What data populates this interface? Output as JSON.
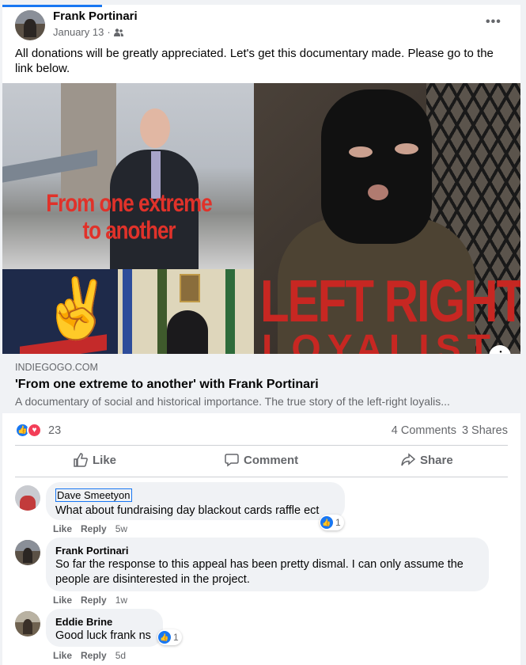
{
  "post": {
    "author": "Frank Portinari",
    "date": "January 13",
    "separator": "·",
    "audience_icon": "friends-icon",
    "more_icon": "more-options-icon",
    "text": "All donations will be greatly appreciated. Let's get this documentary made. Please go to the link below."
  },
  "image": {
    "caption_line1": "From one extreme",
    "caption_line2": "to another",
    "big_text_line1": "LEFT RIGHT",
    "big_text_line2": "LOYALIST"
  },
  "link": {
    "domain": "INDIEGOGO.COM",
    "title": "'From one extreme to another' with Frank Portinari",
    "description": "A documentary of social and historical importance. The true story of the left-right loyalis..."
  },
  "stats": {
    "reaction_count": "23",
    "comments": "4 Comments",
    "shares": "3 Shares"
  },
  "actions": {
    "like": "Like",
    "comment": "Comment",
    "share": "Share"
  },
  "comments": [
    {
      "name": "Dave Smeetyon",
      "text": "What about fundraising day blackout cards raffle ect",
      "like": "Like",
      "reply": "Reply",
      "time": "5w",
      "reactions": "1"
    },
    {
      "name": "Frank Portinari",
      "text": "So far the response to this appeal has been pretty dismal. I can only assume the people are disinterested in the project.",
      "like": "Like",
      "reply": "Reply",
      "time": "1w"
    },
    {
      "name": "Eddie Brine",
      "text": "Good luck frank ns",
      "like": "Like",
      "reply": "Reply",
      "time": "5d",
      "reactions": "1"
    }
  ],
  "colors": {
    "accent": "#1877f2",
    "love": "#f33e58",
    "poster_red": "#c72722"
  }
}
